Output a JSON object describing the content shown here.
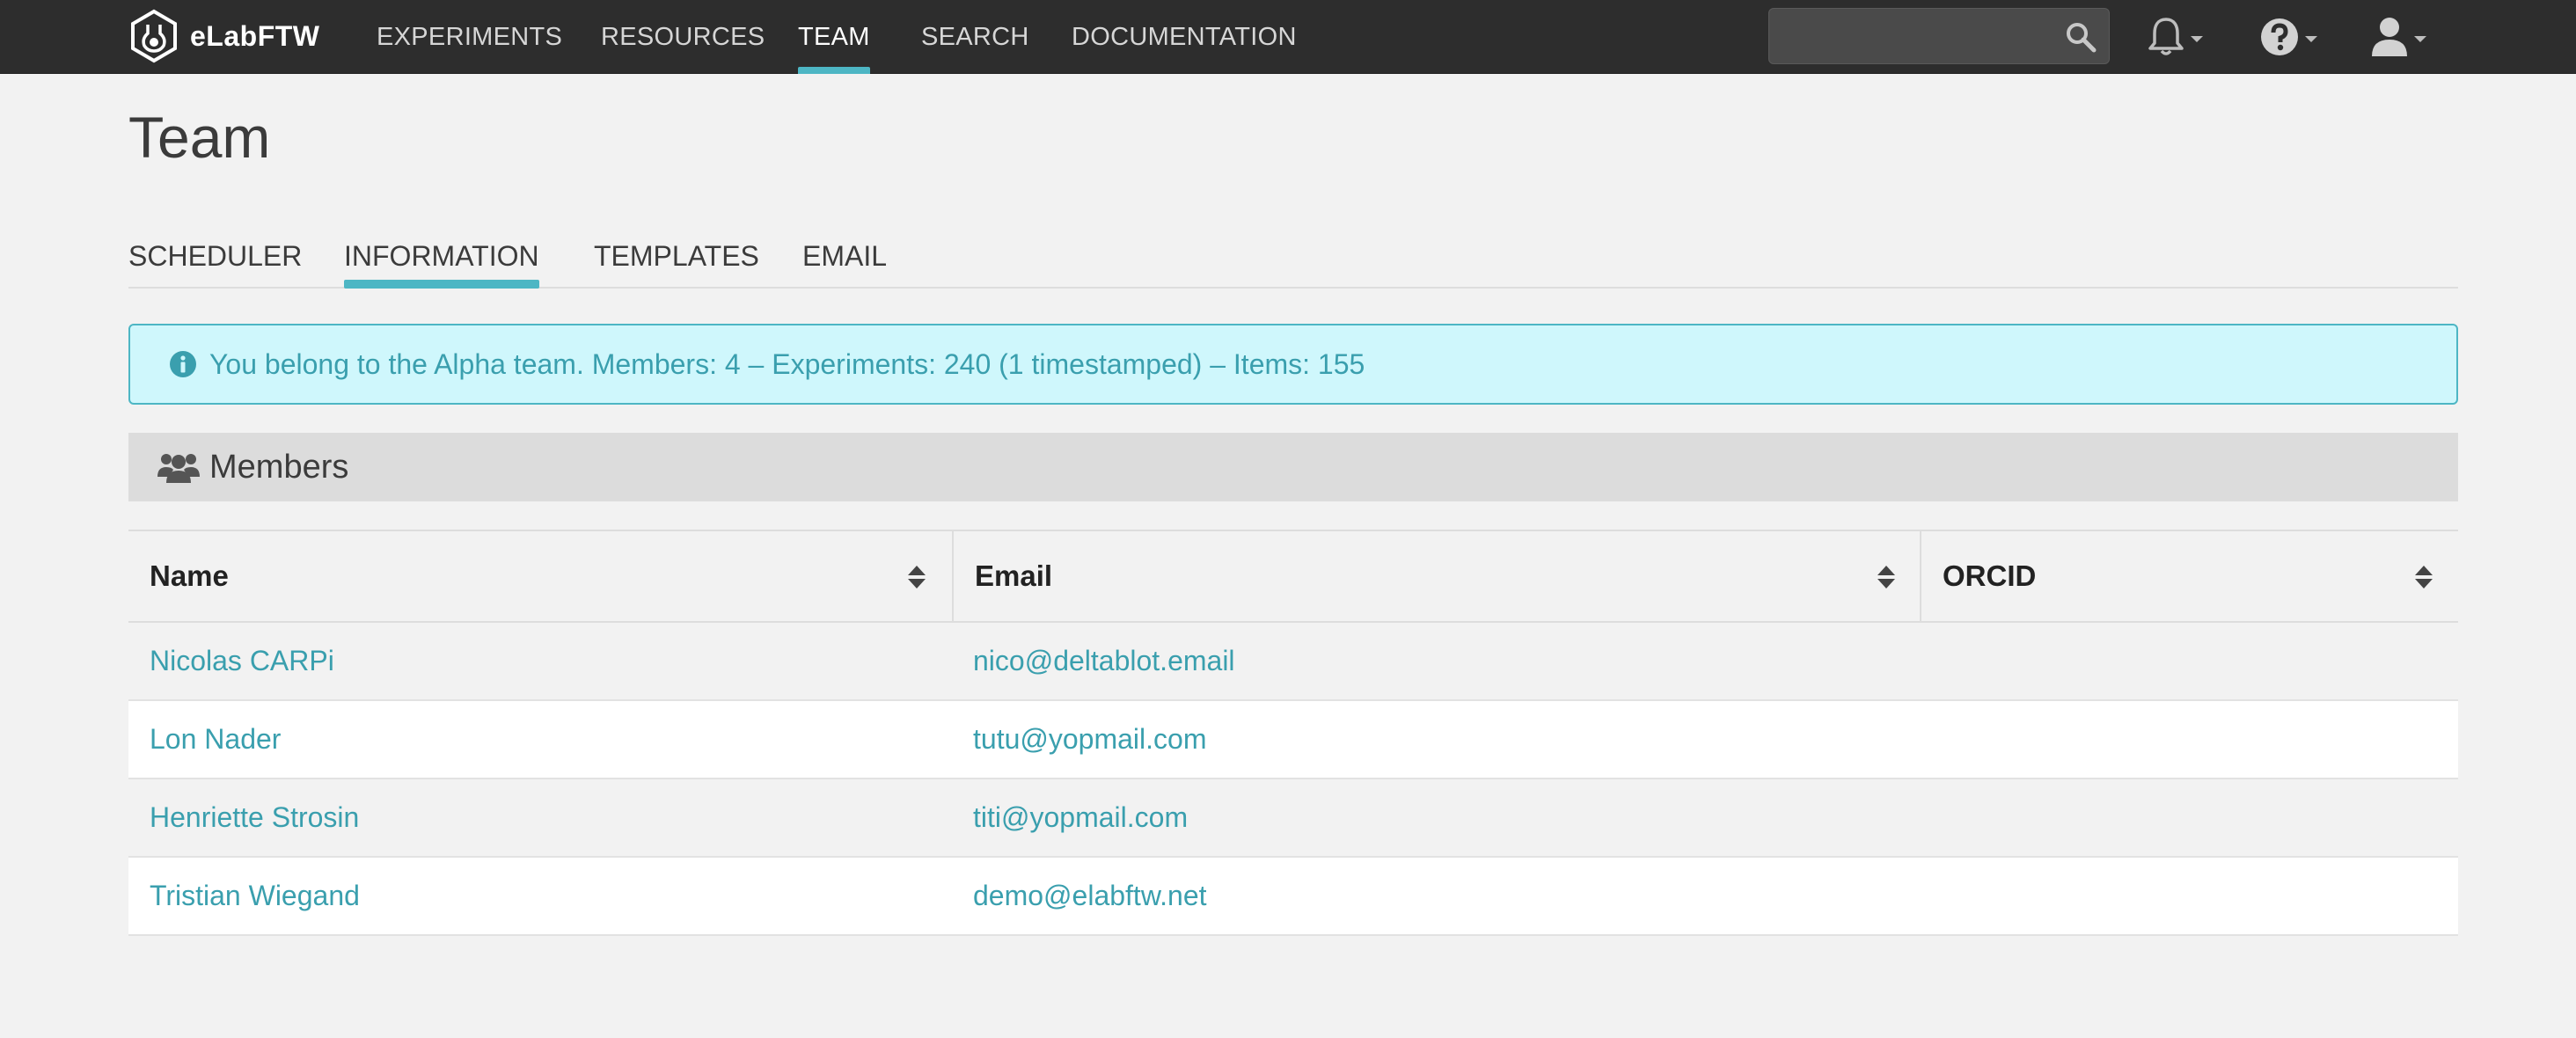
{
  "navbar": {
    "brand": "eLabFTW",
    "links": [
      {
        "label": "EXPERIMENTS",
        "active": false
      },
      {
        "label": "RESOURCES",
        "active": false
      },
      {
        "label": "TEAM",
        "active": true
      },
      {
        "label": "SEARCH",
        "active": false
      },
      {
        "label": "DOCUMENTATION",
        "active": false
      }
    ],
    "search_placeholder": "",
    "icons": [
      "search-icon",
      "bell-icon",
      "help-icon",
      "user-icon"
    ]
  },
  "page": {
    "title": "Team",
    "tabs": [
      {
        "label": "SCHEDULER",
        "active": false
      },
      {
        "label": "INFORMATION",
        "active": true
      },
      {
        "label": "TEMPLATES",
        "active": false
      },
      {
        "label": "EMAIL",
        "active": false
      }
    ],
    "info_alert": "You belong to the Alpha team. Members: 4 – Experiments: 240 (1 timestamped) – Items: 155",
    "members_section": {
      "title": "Members",
      "columns": [
        "Name",
        "Email",
        "ORCID"
      ],
      "rows": [
        {
          "name": "Nicolas CARPi",
          "email": "nico@deltablot.email",
          "orcid": ""
        },
        {
          "name": "Lon Nader",
          "email": "tutu@yopmail.com",
          "orcid": ""
        },
        {
          "name": "Henriette Strosin",
          "email": "titi@yopmail.com",
          "orcid": ""
        },
        {
          "name": "Tristian Wiegand",
          "email": "demo@elabftw.net",
          "orcid": ""
        }
      ]
    }
  },
  "colors": {
    "navbar_bg": "#2d2d2d",
    "accent": "#4db6c4",
    "link": "#3a9fae",
    "alert_bg": "#cff7fc",
    "page_bg": "#f2f2f2"
  }
}
